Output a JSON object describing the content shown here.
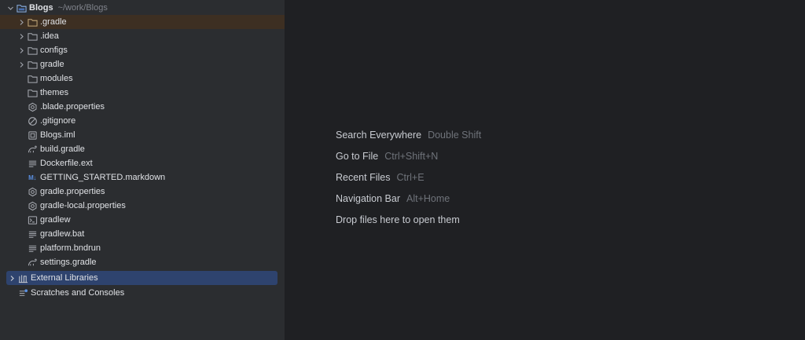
{
  "project": {
    "root": {
      "name": "Blogs",
      "path": "~/work/Blogs"
    },
    "items": [
      {
        "label": ".gradle",
        "icon": "folder-icon",
        "expandable": true
      },
      {
        "label": ".idea",
        "icon": "folder-icon",
        "expandable": true
      },
      {
        "label": "configs",
        "icon": "folder-icon",
        "expandable": true
      },
      {
        "label": "gradle",
        "icon": "folder-icon",
        "expandable": true
      },
      {
        "label": "modules",
        "icon": "folder-icon",
        "expandable": false
      },
      {
        "label": "themes",
        "icon": "folder-icon",
        "expandable": false
      },
      {
        "label": ".blade.properties",
        "icon": "gear-icon",
        "expandable": false
      },
      {
        "label": ".gitignore",
        "icon": "ignore-icon",
        "expandable": false
      },
      {
        "label": "Blogs.iml",
        "icon": "module-file-icon",
        "expandable": false
      },
      {
        "label": "build.gradle",
        "icon": "gradle-icon",
        "expandable": false
      },
      {
        "label": "Dockerfile.ext",
        "icon": "text-file-icon",
        "expandable": false
      },
      {
        "label": "GETTING_STARTED.markdown",
        "icon": "markdown-icon",
        "badge": "M↓",
        "expandable": false
      },
      {
        "label": "gradle.properties",
        "icon": "gear-icon",
        "expandable": false
      },
      {
        "label": "gradle-local.properties",
        "icon": "gear-icon",
        "expandable": false
      },
      {
        "label": "gradlew",
        "icon": "terminal-icon",
        "expandable": false
      },
      {
        "label": "gradlew.bat",
        "icon": "text-file-icon",
        "expandable": false
      },
      {
        "label": "platform.bndrun",
        "icon": "text-file-icon",
        "expandable": false
      },
      {
        "label": "settings.gradle",
        "icon": "gradle-icon",
        "expandable": false
      }
    ],
    "external_libraries": {
      "label": "External Libraries",
      "icon": "library-icon"
    },
    "scratches": {
      "label": "Scratches and Consoles",
      "icon": "scratches-icon"
    }
  },
  "empty_editor": {
    "hints": [
      {
        "action": "Search Everywhere",
        "shortcut": "Double Shift"
      },
      {
        "action": "Go to File",
        "shortcut": "Ctrl+Shift+N"
      },
      {
        "action": "Recent Files",
        "shortcut": "Ctrl+E"
      },
      {
        "action": "Navigation Bar",
        "shortcut": "Alt+Home"
      },
      {
        "action": "Drop files here to open them",
        "shortcut": ""
      }
    ]
  },
  "colors": {
    "panel_bg": "#2b2d30",
    "editor_bg": "#1f2023",
    "selection": "#2e436e",
    "highlight": "#3d2f22"
  }
}
